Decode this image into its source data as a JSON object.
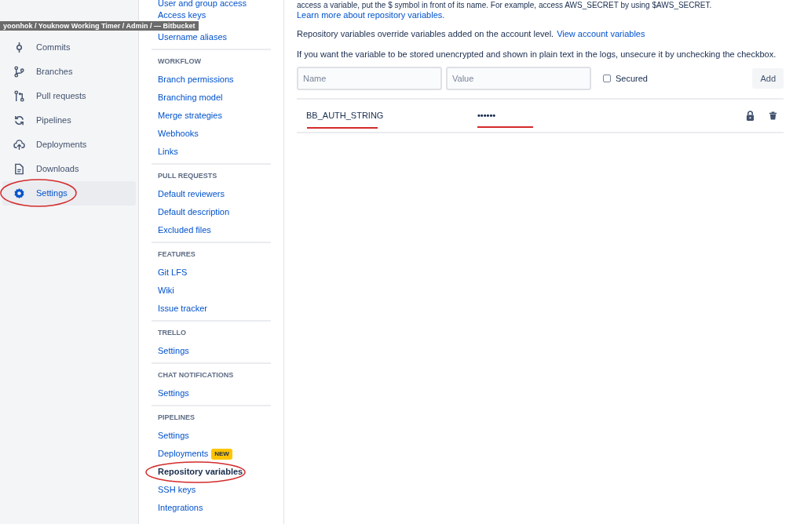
{
  "tooltip": "yoonhok / Youknow Working Timer / Admin / — Bitbucket",
  "nav": [
    {
      "label": "Commits",
      "selected": false
    },
    {
      "label": "Branches",
      "selected": false
    },
    {
      "label": "Pull requests",
      "selected": false
    },
    {
      "label": "Pipelines",
      "selected": false
    },
    {
      "label": "Deployments",
      "selected": false
    },
    {
      "label": "Downloads",
      "selected": false
    },
    {
      "label": "Settings",
      "selected": true
    }
  ],
  "settings_sections": [
    {
      "items": [
        {
          "label": "User and group access",
          "selected": false
        },
        {
          "label": "Access keys",
          "selected": false
        },
        {
          "label": "Username aliases",
          "selected": false
        }
      ]
    },
    {
      "header": "WORKFLOW",
      "items": [
        {
          "label": "Branch permissions",
          "selected": false
        },
        {
          "label": "Branching model",
          "selected": false
        },
        {
          "label": "Merge strategies",
          "selected": false
        },
        {
          "label": "Webhooks",
          "selected": false
        },
        {
          "label": "Links",
          "selected": false
        }
      ]
    },
    {
      "header": "PULL REQUESTS",
      "items": [
        {
          "label": "Default reviewers",
          "selected": false
        },
        {
          "label": "Default description",
          "selected": false
        },
        {
          "label": "Excluded files",
          "selected": false
        }
      ]
    },
    {
      "header": "FEATURES",
      "items": [
        {
          "label": "Git LFS",
          "selected": false
        },
        {
          "label": "Wiki",
          "selected": false
        },
        {
          "label": "Issue tracker",
          "selected": false
        }
      ]
    },
    {
      "header": "TRELLO",
      "items": [
        {
          "label": "Settings",
          "selected": false
        }
      ]
    },
    {
      "header": "CHAT NOTIFICATIONS",
      "items": [
        {
          "label": "Settings",
          "selected": false
        }
      ]
    },
    {
      "header": "PIPELINES",
      "items": [
        {
          "label": "Settings",
          "selected": false
        },
        {
          "label": "Deployments",
          "selected": false,
          "badge": "NEW"
        },
        {
          "label": "Repository variables",
          "selected": true
        },
        {
          "label": "SSH keys",
          "selected": false
        },
        {
          "label": "Integrations",
          "selected": false
        }
      ]
    }
  ],
  "main": {
    "intro_cut": "access a variable, put the $ symbol in front of its name. For example, access AWS_SECRET by using $AWS_SECRET.",
    "learn_more_link": "Learn more about repository variables.",
    "override_text": "Repository variables override variables added on the account level.",
    "account_link": "View account variables",
    "unsecure_text": "If you want the variable to be stored unencrypted and shown in plain text in the logs, unsecure it by unchecking the checkbox.",
    "name_field": {
      "placeholder": "Name"
    },
    "value_field": {
      "placeholder": "Value"
    },
    "secured_checkbox": {
      "label": "Secured",
      "checked": false
    },
    "add_button": "Add",
    "variables": [
      {
        "name": "BB_AUTH_STRING",
        "value": "••••••",
        "secured": true
      }
    ]
  }
}
